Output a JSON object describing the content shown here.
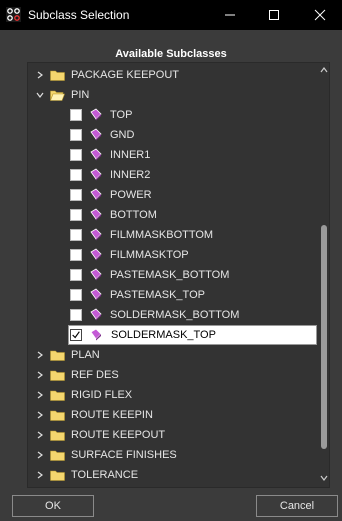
{
  "window": {
    "title": "Subclass Selection"
  },
  "section_label": "Available Subclasses",
  "tree": [
    {
      "type": "folder",
      "label": "PACKAGE KEEPOUT",
      "expanded": false
    },
    {
      "type": "folder",
      "label": "PIN",
      "expanded": true
    },
    {
      "type": "leaf",
      "label": "TOP",
      "checked": false
    },
    {
      "type": "leaf",
      "label": "GND",
      "checked": false
    },
    {
      "type": "leaf",
      "label": "INNER1",
      "checked": false
    },
    {
      "type": "leaf",
      "label": "INNER2",
      "checked": false
    },
    {
      "type": "leaf",
      "label": "POWER",
      "checked": false
    },
    {
      "type": "leaf",
      "label": "BOTTOM",
      "checked": false
    },
    {
      "type": "leaf",
      "label": "FILMMASKBOTTOM",
      "checked": false
    },
    {
      "type": "leaf",
      "label": "FILMMASKTOP",
      "checked": false
    },
    {
      "type": "leaf",
      "label": "PASTEMASK_BOTTOM",
      "checked": false
    },
    {
      "type": "leaf",
      "label": "PASTEMASK_TOP",
      "checked": false
    },
    {
      "type": "leaf",
      "label": "SOLDERMASK_BOTTOM",
      "checked": false
    },
    {
      "type": "leaf",
      "label": "SOLDERMASK_TOP",
      "checked": true,
      "selected": true
    },
    {
      "type": "folder",
      "label": "PLAN",
      "expanded": false
    },
    {
      "type": "folder",
      "label": "REF DES",
      "expanded": false
    },
    {
      "type": "folder",
      "label": "RIGID FLEX",
      "expanded": false
    },
    {
      "type": "folder",
      "label": "ROUTE KEEPIN",
      "expanded": false
    },
    {
      "type": "folder",
      "label": "ROUTE KEEPOUT",
      "expanded": false
    },
    {
      "type": "folder",
      "label": "SURFACE FINISHES",
      "expanded": false
    },
    {
      "type": "folder",
      "label": "TOLERANCE",
      "expanded": false
    }
  ],
  "buttons": {
    "ok": "OK",
    "cancel": "Cancel"
  },
  "colors": {
    "folder": "#f5d76e",
    "diamond": "#c45ad6",
    "titlebar": "#000000"
  }
}
